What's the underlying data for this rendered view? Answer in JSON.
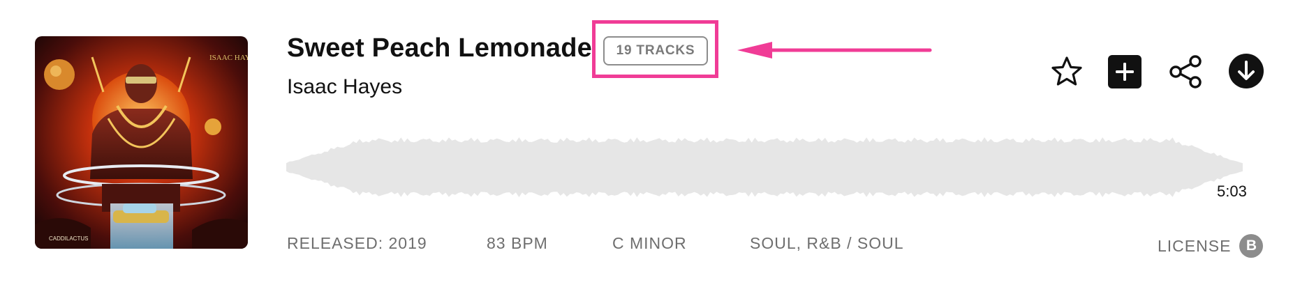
{
  "track": {
    "title": "Sweet Peach Lemonade",
    "artist": "Isaac Hayes",
    "tracks_badge": "19 TRACKS",
    "duration": "5:03"
  },
  "album_art": {
    "text_top": "ISAAC HAYES",
    "text_bottom": "CADDILACTUS"
  },
  "meta": {
    "released": "RELEASED: 2019",
    "bpm": "83 BPM",
    "key": "C MINOR",
    "genre": "SOUL, R&B / SOUL"
  },
  "license": {
    "label": "LICENSE",
    "badge": "B"
  },
  "actions": {
    "favorite_icon": "star-outline-icon",
    "add_icon": "plus-square-icon",
    "share_icon": "share-nodes-icon",
    "download_icon": "download-circle-icon"
  },
  "colors": {
    "highlight": "#f03c96",
    "waveform": "#e6e6e6",
    "meta_text": "#6e6e6e",
    "badge_border": "#8c8c8c"
  }
}
